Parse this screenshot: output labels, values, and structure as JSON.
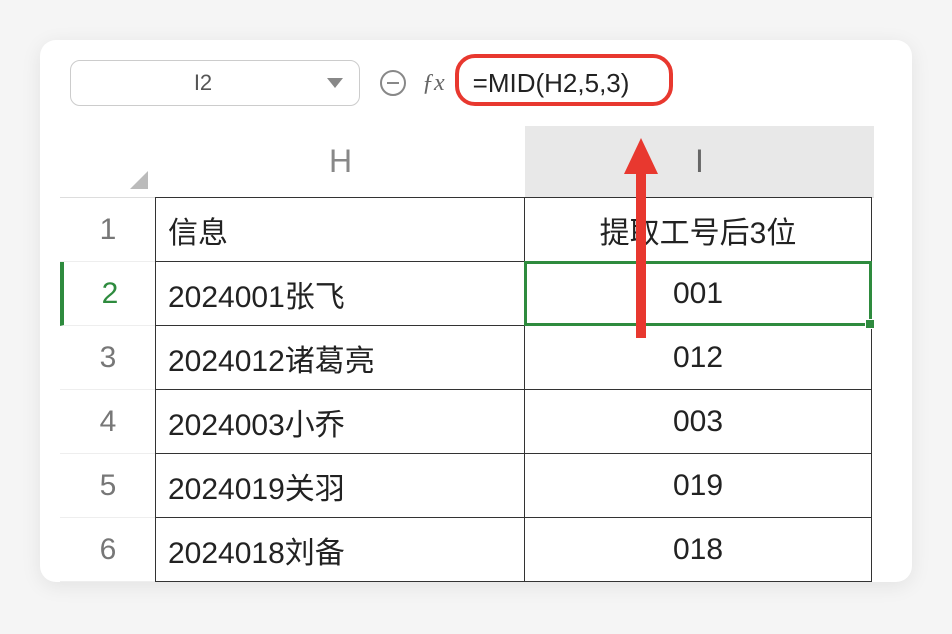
{
  "nameBox": {
    "value": "I2"
  },
  "formulaBar": {
    "formula": "=MID(H2,5,3)"
  },
  "columns": {
    "H": "H",
    "I": "I"
  },
  "headerRow": {
    "H": "信息",
    "I": "提取工号后3位"
  },
  "rows": [
    {
      "num": "1",
      "H": "信息",
      "I": "提取工号后3位"
    },
    {
      "num": "2",
      "H": "2024001张飞",
      "I": "001"
    },
    {
      "num": "3",
      "H": "2024012诸葛亮",
      "I": "012"
    },
    {
      "num": "4",
      "H": "2024003小乔",
      "I": "003"
    },
    {
      "num": "5",
      "H": "2024019关羽",
      "I": "019"
    },
    {
      "num": "6",
      "H": "2024018刘备",
      "I": "018"
    }
  ],
  "activeRow": "2",
  "activeCell": "I2",
  "colors": {
    "accent": "#2e8b3e",
    "highlight": "#e8382f"
  }
}
